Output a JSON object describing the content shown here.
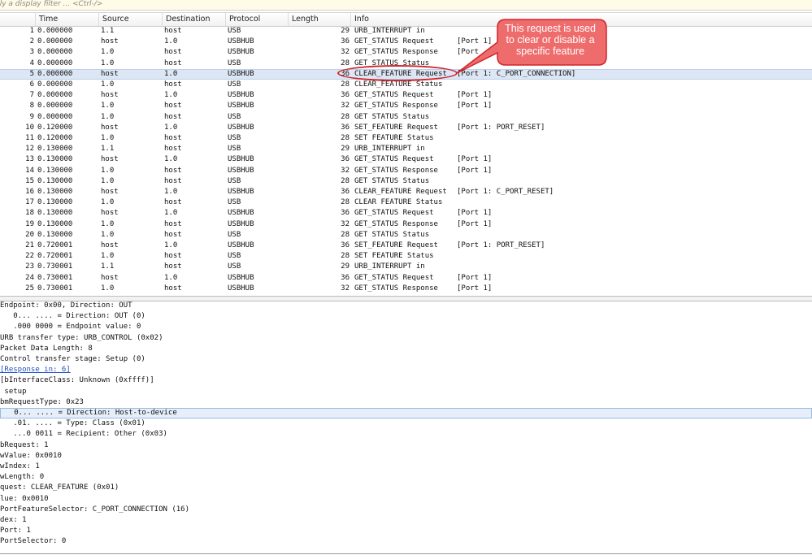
{
  "filter": {
    "placeholder": "ply a display filter ... <Ctrl-/>"
  },
  "columns": {
    "time": "Time",
    "source": "Source",
    "destination": "Destination",
    "protocol": "Protocol",
    "length": "Length",
    "info": "Info"
  },
  "packets": [
    {
      "no": "1",
      "time": "0.000000",
      "src": "1.1",
      "dst": "host",
      "proto": "USB",
      "len": "29",
      "info": "URB_INTERRUPT in",
      "port": ""
    },
    {
      "no": "2",
      "time": "0.000000",
      "src": "host",
      "dst": "1.0",
      "proto": "USBHUB",
      "len": "36",
      "info": "GET_STATUS Request",
      "port": "[Port 1]"
    },
    {
      "no": "3",
      "time": "0.000000",
      "src": "1.0",
      "dst": "host",
      "proto": "USBHUB",
      "len": "32",
      "info": "GET_STATUS Response",
      "port": "[Port"
    },
    {
      "no": "4",
      "time": "0.000000",
      "src": "1.0",
      "dst": "host",
      "proto": "USB",
      "len": "28",
      "info": "GET_STATUS Status",
      "port": ""
    },
    {
      "no": "5",
      "time": "0.000000",
      "src": "host",
      "dst": "1.0",
      "proto": "USBHUB",
      "len": "36",
      "info": "CLEAR_FEATURE Request",
      "port": "[Port 1: C_PORT_CONNECTION]"
    },
    {
      "no": "6",
      "time": "0.000000",
      "src": "1.0",
      "dst": "host",
      "proto": "USB",
      "len": "28",
      "info": "CLEAR_FEATURE Status",
      "port": ""
    },
    {
      "no": "7",
      "time": "0.000000",
      "src": "host",
      "dst": "1.0",
      "proto": "USBHUB",
      "len": "36",
      "info": "GET_STATUS Request",
      "port": "[Port 1]"
    },
    {
      "no": "8",
      "time": "0.000000",
      "src": "1.0",
      "dst": "host",
      "proto": "USBHUB",
      "len": "32",
      "info": "GET_STATUS Response",
      "port": "[Port 1]"
    },
    {
      "no": "9",
      "time": "0.000000",
      "src": "1.0",
      "dst": "host",
      "proto": "USB",
      "len": "28",
      "info": "GET STATUS Status",
      "port": ""
    },
    {
      "no": "10",
      "time": "0.120000",
      "src": "host",
      "dst": "1.0",
      "proto": "USBHUB",
      "len": "36",
      "info": "SET_FEATURE Request",
      "port": "[Port 1: PORT_RESET]"
    },
    {
      "no": "11",
      "time": "0.120000",
      "src": "1.0",
      "dst": "host",
      "proto": "USB",
      "len": "28",
      "info": "SET FEATURE Status",
      "port": ""
    },
    {
      "no": "12",
      "time": "0.130000",
      "src": "1.1",
      "dst": "host",
      "proto": "USB",
      "len": "29",
      "info": "URB_INTERRUPT in",
      "port": ""
    },
    {
      "no": "13",
      "time": "0.130000",
      "src": "host",
      "dst": "1.0",
      "proto": "USBHUB",
      "len": "36",
      "info": "GET_STATUS Request",
      "port": "[Port 1]"
    },
    {
      "no": "14",
      "time": "0.130000",
      "src": "1.0",
      "dst": "host",
      "proto": "USBHUB",
      "len": "32",
      "info": "GET_STATUS Response",
      "port": "[Port 1]"
    },
    {
      "no": "15",
      "time": "0.130000",
      "src": "1.0",
      "dst": "host",
      "proto": "USB",
      "len": "28",
      "info": "GET STATUS Status",
      "port": ""
    },
    {
      "no": "16",
      "time": "0.130000",
      "src": "host",
      "dst": "1.0",
      "proto": "USBHUB",
      "len": "36",
      "info": "CLEAR_FEATURE Request",
      "port": "[Port 1: C_PORT_RESET]"
    },
    {
      "no": "17",
      "time": "0.130000",
      "src": "1.0",
      "dst": "host",
      "proto": "USB",
      "len": "28",
      "info": "CLEAR FEATURE Status",
      "port": ""
    },
    {
      "no": "18",
      "time": "0.130000",
      "src": "host",
      "dst": "1.0",
      "proto": "USBHUB",
      "len": "36",
      "info": "GET_STATUS Request",
      "port": "[Port 1]"
    },
    {
      "no": "19",
      "time": "0.130000",
      "src": "1.0",
      "dst": "host",
      "proto": "USBHUB",
      "len": "32",
      "info": "GET_STATUS Response",
      "port": "[Port 1]"
    },
    {
      "no": "20",
      "time": "0.130000",
      "src": "1.0",
      "dst": "host",
      "proto": "USB",
      "len": "28",
      "info": "GET STATUS Status",
      "port": ""
    },
    {
      "no": "21",
      "time": "0.720001",
      "src": "host",
      "dst": "1.0",
      "proto": "USBHUB",
      "len": "36",
      "info": "SET_FEATURE Request",
      "port": "[Port 1: PORT_RESET]"
    },
    {
      "no": "22",
      "time": "0.720001",
      "src": "1.0",
      "dst": "host",
      "proto": "USB",
      "len": "28",
      "info": "SET FEATURE Status",
      "port": ""
    },
    {
      "no": "23",
      "time": "0.730001",
      "src": "1.1",
      "dst": "host",
      "proto": "USB",
      "len": "29",
      "info": "URB_INTERRUPT in",
      "port": ""
    },
    {
      "no": "24",
      "time": "0.730001",
      "src": "host",
      "dst": "1.0",
      "proto": "USBHUB",
      "len": "36",
      "info": "GET_STATUS Request",
      "port": "[Port 1]"
    },
    {
      "no": "25",
      "time": "0.730001",
      "src": "1.0",
      "dst": "host",
      "proto": "USBHUB",
      "len": "32",
      "info": "GET_STATUS Response",
      "port": "[Port 1]"
    }
  ],
  "selected_packet_no": "5",
  "details": [
    "Endpoint: 0x00, Direction: OUT",
    "   0... .... = Direction: OUT (0)",
    "   .000 0000 = Endpoint value: 0",
    "URB transfer type: URB_CONTROL (0x02)",
    "Packet Data Length: 8",
    "Control transfer stage: Setup (0)",
    "[Response in: 6]",
    "[bInterfaceClass: Unknown (0xffff)]",
    " setup",
    "bmRequestType: 0x23",
    "   0... .... = Direction: Host-to-device",
    "   .01. .... = Type: Class (0x01)",
    "   ...0 0011 = Recipient: Other (0x03)",
    "bRequest: 1",
    "wValue: 0x0010",
    "wIndex: 1",
    "wLength: 0",
    "quest: CLEAR_FEATURE (0x01)",
    "lue: 0x0010",
    "PortFeatureSelector: C_PORT_CONNECTION (16)",
    "dex: 1",
    "Port: 1",
    "PortSelector: 0",
    "   "
  ],
  "details_link_index": 6,
  "details_selected_index": 10,
  "annotation": {
    "line1": "This request is used",
    "line2": "to clear or disable a",
    "line3": "specific feature",
    "fill_color": "#ee6c6c",
    "stroke_color": "#d2242b"
  }
}
